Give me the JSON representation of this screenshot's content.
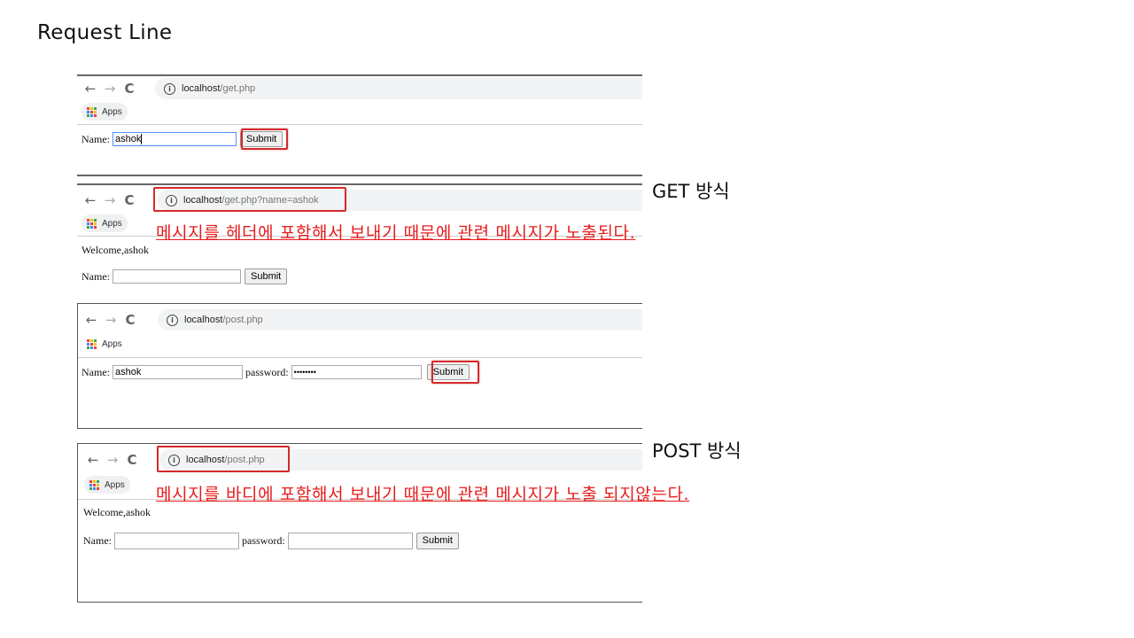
{
  "slide": {
    "title": "Request Line"
  },
  "colors": {
    "highlight": "#d42a2a",
    "note_text": "#e81c1c",
    "omnibox_bg": "#f1f3f4"
  },
  "icons": {
    "back": "arrow-left-icon",
    "forward": "arrow-right-icon",
    "reload": "reload-icon",
    "info": "info-icon",
    "apps": "apps-grid-icon"
  },
  "browser": {
    "apps_label": "Apps",
    "back_glyph": "←",
    "forward_glyph": "→",
    "reload_glyph": "C",
    "info_glyph": "i"
  },
  "shots": [
    {
      "url_host": "localhost",
      "url_path": "/get.php",
      "form": {
        "name_label": "Name:",
        "name_value": "ashok",
        "submit_label": "Submit"
      }
    },
    {
      "url_host": "localhost",
      "url_path": "/get.php?name=ashok",
      "welcome": "Welcome,ashok",
      "form": {
        "name_label": "Name:",
        "name_value": "",
        "submit_label": "Submit"
      }
    },
    {
      "url_host": "localhost",
      "url_path": "/post.php",
      "form": {
        "name_label": "Name:",
        "name_value": "ashok",
        "password_label": "password:",
        "password_value": "••••••••",
        "submit_label": "Submit"
      }
    },
    {
      "url_host": "localhost",
      "url_path": "/post.php",
      "welcome": "Welcome,ashok",
      "form": {
        "name_label": "Name:",
        "name_value": "",
        "password_label": "password:",
        "password_value": "",
        "submit_label": "Submit"
      }
    }
  ],
  "annotations": {
    "get_label": "GET 방식",
    "get_note": "메시지를 헤더에 포함해서 보내기 때문에 관련 메시지가 노출된다.",
    "post_label": "POST 방식",
    "post_note": "메시지를 바디에 포함해서 보내기 때문에 관련 메시지가 노출 되지않는다."
  }
}
